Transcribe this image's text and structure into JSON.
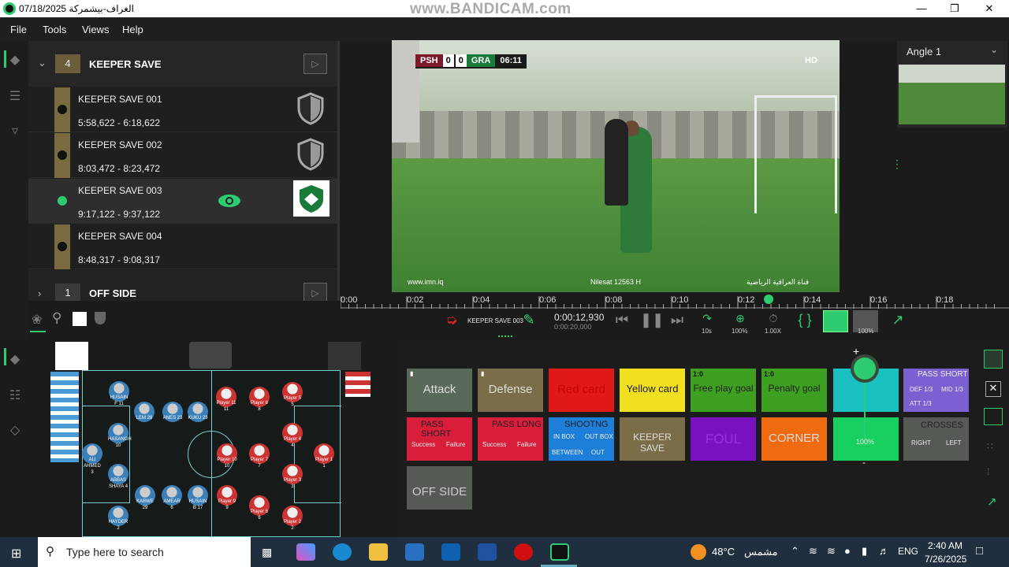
{
  "title_bar": {
    "title": "الغراف-بيشمركة 07/18/2025",
    "watermark": "www.BANDICAM.com",
    "minimize": "—",
    "restore": "❐",
    "close": "✕"
  },
  "menu": [
    "File",
    "Tools",
    "Views",
    "Help"
  ],
  "categories": [
    {
      "count": "4",
      "name": "KEEPER SAVE",
      "expanded": true
    },
    {
      "count": "1",
      "name": "OFF SIDE",
      "expanded": false
    }
  ],
  "clips": [
    {
      "name": "KEEPER SAVE 001",
      "time": "5:58,622 - 6:18,622",
      "selected": false
    },
    {
      "name": "KEEPER SAVE 002",
      "time": "8:03,472 - 8:23,472",
      "selected": false
    },
    {
      "name": "KEEPER SAVE 003",
      "time": "9:17,122 - 9:37,122",
      "selected": true
    },
    {
      "name": "KEEPER SAVE 004",
      "time": "8:48,317 - 9:08,317",
      "selected": false
    }
  ],
  "video": {
    "home": "PSH",
    "home_score": "0",
    "away_score": "0",
    "away": "GRA",
    "clock": "06:11",
    "hd": "HD",
    "site": "www.imn.iq",
    "nilesat": "Nilesat 12563 H",
    "channel": "قناة العراقية الرياضية"
  },
  "angle": {
    "label": "Angle 1"
  },
  "timeline": {
    "ticks": [
      "0:00",
      "0:02",
      "0:04",
      "0:06",
      "0:08",
      "0:10",
      "0:12",
      "0:14",
      "0:16",
      "0:18"
    ],
    "playhead": 12.93
  },
  "transport": {
    "clip_label": "KEEPER SAVE 003",
    "current_time": "0:00:12,930",
    "total_time": "0:00:20,000",
    "skip": "10s",
    "zoom": "100%",
    "speed": "1.00X",
    "volume": "100%"
  },
  "players": {
    "home": [
      {
        "name": "HUSAIN F",
        "num": "11"
      },
      {
        "name": "LEM",
        "num": "28"
      },
      {
        "name": "ANES",
        "num": "23"
      },
      {
        "name": "KUKU",
        "num": "23"
      },
      {
        "name": "HASANGH",
        "num": "10"
      },
      {
        "name": "ALI AHMED",
        "num": "3"
      },
      {
        "name": "ABBAS SHAYA",
        "num": "4"
      },
      {
        "name": "KABWE",
        "num": "29"
      },
      {
        "name": "AMEAR",
        "num": "6"
      },
      {
        "name": "HUSAIN B",
        "num": "17"
      },
      {
        "name": "HAYDER",
        "num": "2"
      }
    ],
    "away": [
      {
        "name": "Player 11",
        "num": "11"
      },
      {
        "name": "Player 8",
        "num": "8"
      },
      {
        "name": "Player 5",
        "num": "5"
      },
      {
        "name": "Player 4",
        "num": "4"
      },
      {
        "name": "Player 10",
        "num": "10"
      },
      {
        "name": "Player 7",
        "num": "7"
      },
      {
        "name": "Player 3",
        "num": "3"
      },
      {
        "name": "Player 1",
        "num": "1"
      },
      {
        "name": "Player 9",
        "num": "9"
      },
      {
        "name": "Player 6",
        "num": "6"
      },
      {
        "name": "Player 2",
        "num": "2"
      }
    ]
  },
  "code_buttons": {
    "attack": "Attack",
    "defense": "Defense",
    "red_card": "Red card",
    "yellow_card": "Yellow card",
    "free_play_goal": "Free play goal",
    "penalty_goal": "Penalty goal",
    "score_tag": "1:0",
    "pass_short": "PASS SHORT",
    "pass_long": "PASS LONG",
    "success": "Success",
    "failure": "Failure",
    "shooting": "SHOOTNG",
    "in_box": "IN BOX",
    "out_box": "OUT BOX",
    "between": "BETWEEN",
    "out": "OUT",
    "keeper_save": "KEEPER SAVE",
    "foul": "FOUL",
    "corner": "CORNER",
    "off_side": "OFF SIDE",
    "pass_short_r": "PASS SHORT",
    "def13": "DEF 1/3",
    "mid13": "MID 1/3",
    "att13": "ATT 1/3",
    "crosses": "CROSSES",
    "right": "RIGHT",
    "left": "LEFT",
    "vol_plus": "+",
    "vol_minus": "-",
    "vol_pct": "100%"
  },
  "taskbar": {
    "search": "Type here to search",
    "temp": "48°C",
    "weather": "مشمس",
    "lang": "ENG",
    "time": "2:40 AM",
    "date": "7/26/2025"
  },
  "colors": {
    "accent": "#2ecc71",
    "attack": "#5a6a5a",
    "defense": "#7a6d48",
    "red": "#e01818",
    "yellow": "#f0e020",
    "green": "#3ea020",
    "pink": "#d81e3a",
    "blue": "#1e7fd8",
    "brown": "#7a6d48",
    "purple": "#7a10c0",
    "orange": "#f06a10",
    "lavender": "#7a60d0",
    "gray": "#555a55"
  }
}
